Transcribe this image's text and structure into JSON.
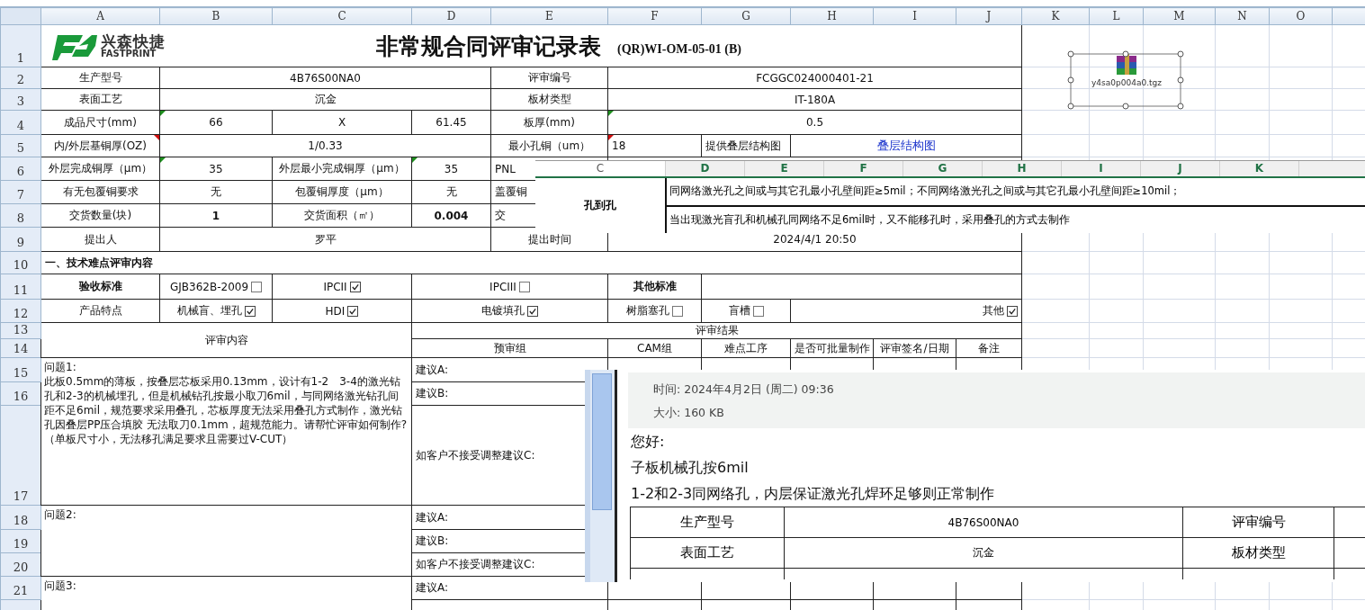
{
  "columns": [
    "A",
    "B",
    "C",
    "D",
    "E",
    "F",
    "G",
    "H",
    "I",
    "J",
    "K",
    "L",
    "M",
    "N",
    "O"
  ],
  "rows": [
    {
      "num": "1",
      "cells": [
        {
          "kind": "title",
          "brand": "兴森快捷",
          "brand_en": "FASTPRINT",
          "title": "非常规合同评审记录表",
          "code": "(QR)WI-OM-05-01 (B)"
        }
      ]
    },
    {
      "num": "2",
      "cells": [
        {
          "text": "生产型号"
        },
        {
          "text": "4B76S00NA0"
        },
        {
          "text": "评审编号"
        },
        {
          "text": "FCGGC024000401-21"
        }
      ]
    },
    {
      "num": "3",
      "cells": [
        {
          "text": "表面工艺"
        },
        {
          "text": "沉金"
        },
        {
          "text": "板材类型"
        },
        {
          "text": "IT-180A"
        }
      ]
    },
    {
      "num": "4",
      "cells": [
        {
          "text": "成品尺寸(mm)"
        },
        {
          "text": "66",
          "color": "#1f8f1f"
        },
        {
          "text": "X"
        },
        {
          "text": "61.45"
        },
        {
          "text": "板厚(mm)"
        },
        {
          "text": "0.5",
          "color": "#1f8f1f"
        }
      ]
    },
    {
      "num": "5",
      "cells": [
        {
          "text": "内/外层基铜厚(OZ)",
          "color": "#d01010"
        },
        {
          "text": "1/0.33"
        },
        {
          "text": "最小孔铜（um）"
        },
        {
          "text": "18",
          "color": "#d01010"
        },
        {
          "text": "提供叠层结构图"
        },
        {
          "text": "叠层结构图",
          "kind": "link"
        }
      ]
    },
    {
      "num": "6",
      "cells": [
        {
          "text": "外层完成铜厚（μm）"
        },
        {
          "text": "35",
          "color": "#1f8f1f"
        },
        {
          "text": "外层最小完成铜厚（μm）"
        },
        {
          "text": "35",
          "color": "#1f8f1f"
        },
        {
          "text": "PNL"
        },
        {}
      ]
    },
    {
      "num": "7",
      "cells": [
        {
          "text": "有无包覆铜要求"
        },
        {
          "text": "无"
        },
        {
          "text": "包覆铜厚度（μm）"
        },
        {
          "text": "无"
        },
        {
          "text": "盖覆铜"
        },
        {}
      ]
    },
    {
      "num": "8",
      "cells": [
        {
          "text": "交货数量(块)"
        },
        {
          "text": "1"
        },
        {
          "text": "交货面积（㎡）"
        },
        {
          "text": "0.004"
        },
        {
          "text": "交"
        },
        {}
      ]
    },
    {
      "num": "9",
      "cells": [
        {
          "text": "提出人"
        },
        {
          "text": "罗平"
        },
        {
          "text": "提出时间"
        },
        {
          "text": "2024/4/1 20:50"
        }
      ]
    },
    {
      "num": "10",
      "cells": [
        {
          "text": "一、技术难点评审内容"
        }
      ]
    },
    {
      "num": "11",
      "cells": [
        {
          "text": "验收标准"
        },
        {
          "kind": "check",
          "text": "GJB362B-2009",
          "checked": false
        },
        {
          "kind": "check",
          "text": "IPCII",
          "checked": true
        },
        {
          "kind": "check",
          "text": "IPCIII",
          "checked": false
        },
        {
          "text": "其他标准"
        },
        {}
      ]
    },
    {
      "num": "12",
      "cells": [
        {
          "text": "产品特点"
        },
        {
          "kind": "check",
          "text": "机械盲、埋孔",
          "checked": true
        },
        {
          "kind": "check",
          "text": "HDI",
          "checked": true
        },
        {
          "kind": "check",
          "text": "电镀填孔",
          "checked": true
        },
        {
          "kind": "check",
          "text": "树脂塞孔",
          "checked": false
        },
        {
          "kind": "check",
          "text": "盲槽",
          "checked": false
        },
        {
          "kind": "check",
          "text": "其他",
          "checked": true
        }
      ]
    },
    {
      "num": "13",
      "cells": [
        {
          "text": "评审内容"
        },
        {
          "text": "评审结果"
        }
      ]
    },
    {
      "num": "14",
      "cells": [
        {
          "text": "预审组"
        },
        {
          "text": "CAM组"
        },
        {
          "text": "难点工序"
        },
        {
          "text": "是否可批量制作"
        },
        {
          "text": "评审签名/日期"
        },
        {
          "text": "备注"
        }
      ]
    },
    {
      "num": "15",
      "cells": [
        {
          "kind": "note",
          "text": "问题1:\n此板0.5mm的薄板，按叠层芯板采用0.13mm，设计有1-2　3-4的激光钻孔和2-3的机械埋孔，但是机械钻孔按最小取刀6mil，与同网络激光钻孔间距不足6mil，规范要求采用叠孔，芯板厚度无法采用叠孔方式制作，激光钻孔因叠层PP压合填胶 无法取刀0.1mm，超规范能力。请帮忙评审如何制作?\n（单板尺寸小，无法移孔满足要求且需要过V-CUT）"
        },
        {
          "text": "建议A:"
        },
        {},
        {},
        {},
        {},
        {}
      ]
    },
    {
      "num": "16",
      "cells": [
        {
          "text": "建议B:"
        },
        {},
        {},
        {},
        {},
        {}
      ]
    },
    {
      "num": "17",
      "cells": [
        {
          "text": "如客户不接受调整建议C:"
        },
        {},
        {},
        {},
        {},
        {}
      ]
    },
    {
      "num": "18",
      "cells": [
        {
          "kind": "note",
          "text": "问题2:"
        },
        {
          "text": "建议A:"
        },
        {},
        {},
        {},
        {},
        {}
      ]
    },
    {
      "num": "19",
      "cells": [
        {
          "text": "建议B:"
        },
        {},
        {},
        {},
        {},
        {}
      ]
    },
    {
      "num": "20",
      "cells": [
        {
          "text": "如客户不接受调整建议C:"
        },
        {},
        {},
        {},
        {},
        {}
      ]
    },
    {
      "num": "21",
      "cells": [
        {
          "kind": "note",
          "text": "问题3:"
        },
        {
          "text": "建议A:"
        },
        {},
        {},
        {},
        {},
        {}
      ]
    },
    {
      "cells": [
        {},
        {},
        {},
        {},
        {},
        {}
      ]
    }
  ],
  "attachment": {
    "filename": "y4sa0p004a0.tgz"
  },
  "snippet": {
    "columns": [
      "C",
      "D",
      "E",
      "F",
      "G",
      "H",
      "I",
      "J",
      "K"
    ],
    "label": "孔到孔",
    "lines": [
      "同网络激光孔之间或与其它孔最小孔壁间距≥5mil；不同网络激光孔之间或与其它孔最小孔壁间距≥10mil；",
      "当出现激光盲孔和机械孔同网络不足6mil时，又不能移孔时，采用叠孔的方式去制作"
    ]
  },
  "email": {
    "time": "时间: 2024年4月2日 (周二) 09:36",
    "size": "大小: 160 KB",
    "lines": [
      "您好:",
      "子板机械孔按6mil",
      "1-2和2-3同网络孔，内层保证激光孔焊环足够则正常制作"
    ],
    "table": [
      [
        "生产型号",
        "4B76S00NA0",
        "评审编号"
      ],
      [
        "表面工艺",
        "沉金",
        "板材类型"
      ]
    ]
  }
}
